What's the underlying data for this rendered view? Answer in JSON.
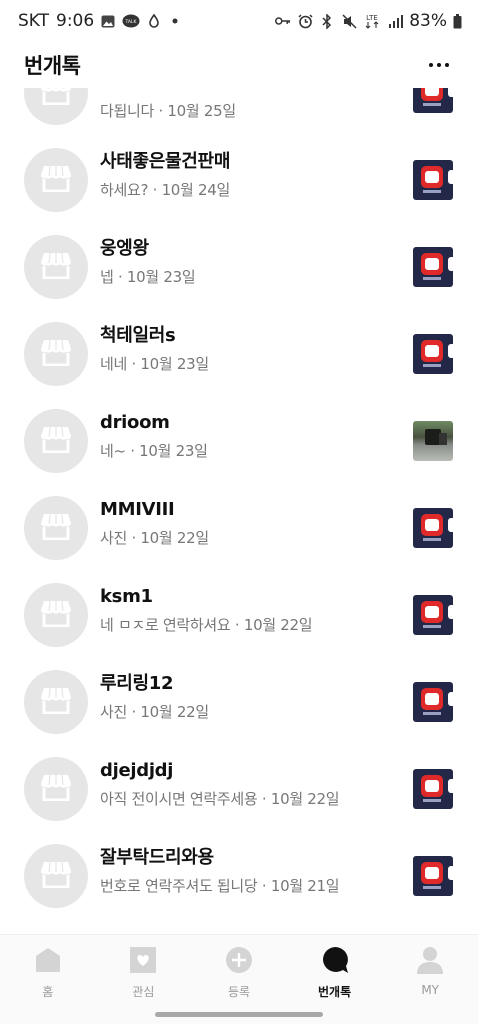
{
  "status_bar": {
    "carrier": "SKT",
    "time": "9:06",
    "talk_badge": "TALK",
    "lte": "LTE",
    "battery": "83%",
    "icons": [
      "gallery-icon",
      "talk-icon",
      "notification-icon",
      "dot-icon",
      "key-icon",
      "alarm-icon",
      "bluetooth-icon",
      "mute-icon",
      "signal-icon",
      "battery-icon"
    ]
  },
  "header": {
    "title": "번개톡",
    "more_icon": "more-horizontal-icon"
  },
  "chats": [
    {
      "name": "",
      "preview": "다됩니다 · 10월 25일",
      "thumb": "app-logo"
    },
    {
      "name": "사태좋은물건판매",
      "preview": "하세요? · 10월 24일",
      "thumb": "app-logo"
    },
    {
      "name": "웅엥왕",
      "preview": "넵 · 10월 23일",
      "thumb": "app-logo"
    },
    {
      "name": "척테일러s",
      "preview": "네네 · 10월 23일",
      "thumb": "app-logo"
    },
    {
      "name": "drioom",
      "preview": "네~ · 10월 23일",
      "thumb": "photo"
    },
    {
      "name": "MMIVIII",
      "preview": "사진 · 10월 22일",
      "thumb": "app-logo"
    },
    {
      "name": "ksm1",
      "preview": "네 ㅁㅈ로 연락하셔요 · 10월 22일",
      "thumb": "app-logo"
    },
    {
      "name": "루리링12",
      "preview": "사진 · 10월 22일",
      "thumb": "app-logo"
    },
    {
      "name": "djejdjdj",
      "preview": "아직 전이시면 연락주세용 · 10월 22일",
      "thumb": "app-logo"
    },
    {
      "name": "잘부탁드리와용",
      "preview": "번호로 연락주셔도 됩니당 · 10월 21일",
      "thumb": "app-logo"
    }
  ],
  "bottom_nav": {
    "items": [
      {
        "label": "홈",
        "icon": "home-icon"
      },
      {
        "label": "관심",
        "icon": "heart-icon"
      },
      {
        "label": "등록",
        "icon": "plus-circle-icon"
      },
      {
        "label": "번개톡",
        "icon": "chat-bubble-icon",
        "active": true
      },
      {
        "label": "MY",
        "icon": "profile-icon"
      }
    ]
  },
  "colors": {
    "avatar_bg": "#e6e6e6",
    "thumb_bg": "#232848",
    "logo_red": "#e02a2a",
    "active_nav": "#111111",
    "inactive_nav": "#9a9a9a"
  }
}
